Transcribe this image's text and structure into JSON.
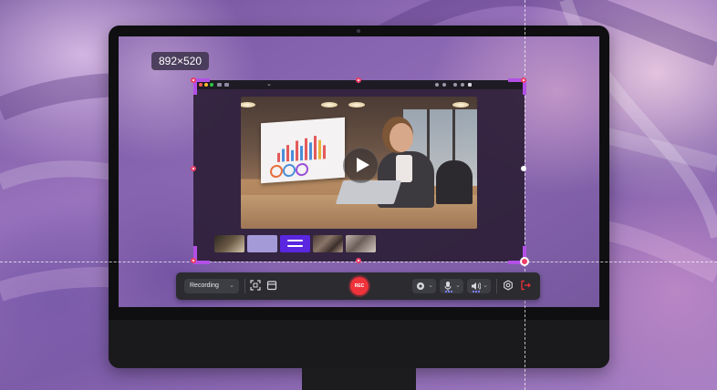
{
  "selection": {
    "size_label": "892×520"
  },
  "player": {
    "control": "play-icon"
  },
  "thumbnails": [
    {
      "name": "thumbnail-office-photo"
    },
    {
      "name": "thumbnail-lavender"
    },
    {
      "name": "thumbnail-purple-slide"
    },
    {
      "name": "thumbnail-team-photo"
    },
    {
      "name": "thumbnail-meeting-photo"
    }
  ],
  "toolbar": {
    "mode": "Recording",
    "rec_label": "REC",
    "icons": [
      "region-icon",
      "calendar-icon",
      "webcam-icon",
      "microphone-icon",
      "speaker-icon",
      "settings-icon",
      "exit-icon"
    ]
  },
  "colors": {
    "accent": "#b24fe6",
    "handle": "#ec3f67",
    "record": "#f0323b",
    "toolbar_bg": "#2b2b30"
  }
}
